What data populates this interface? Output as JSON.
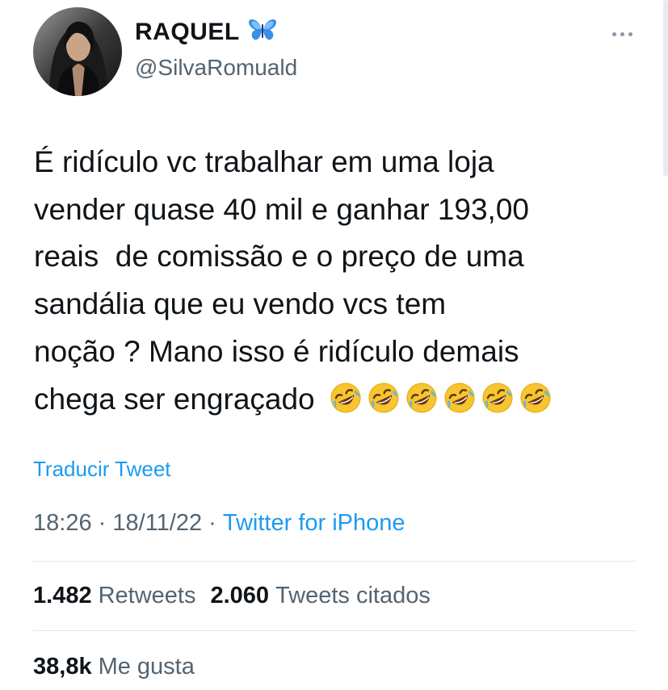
{
  "author": {
    "display_name": "RAQUEL",
    "name_emoji": "butterfly-icon",
    "handle": "@SilvaRomuald"
  },
  "tweet": {
    "lines": [
      "É ridículo vc trabalhar em uma loja",
      "vender quase 40 mil e ganhar 193,00",
      "reais  de comissão e o preço de uma",
      "sandália que eu vendo vcs tem",
      "noção ? Mano isso é ridículo demais",
      "chega ser engraçado"
    ],
    "emoji": [
      "rofl-emoji",
      "rofl-emoji",
      "rofl-emoji",
      "rofl-emoji",
      "rofl-emoji",
      "rofl-emoji"
    ]
  },
  "translate_label": "Traducir Tweet",
  "meta": {
    "time": "18:26",
    "sep1": " · ",
    "date": "18/11/22",
    "sep2": " · ",
    "source": "Twitter for iPhone"
  },
  "stats": {
    "retweets_count": "1.482",
    "retweets_label": "Retweets",
    "quotes_count": "2.060",
    "quotes_label": "Tweets citados",
    "likes_count": "38,8k",
    "likes_label": "Me gusta"
  },
  "colors": {
    "accent": "#1d9bf0",
    "text_primary": "#0f1419",
    "text_secondary": "#536471",
    "divider": "#e3e6e8"
  }
}
